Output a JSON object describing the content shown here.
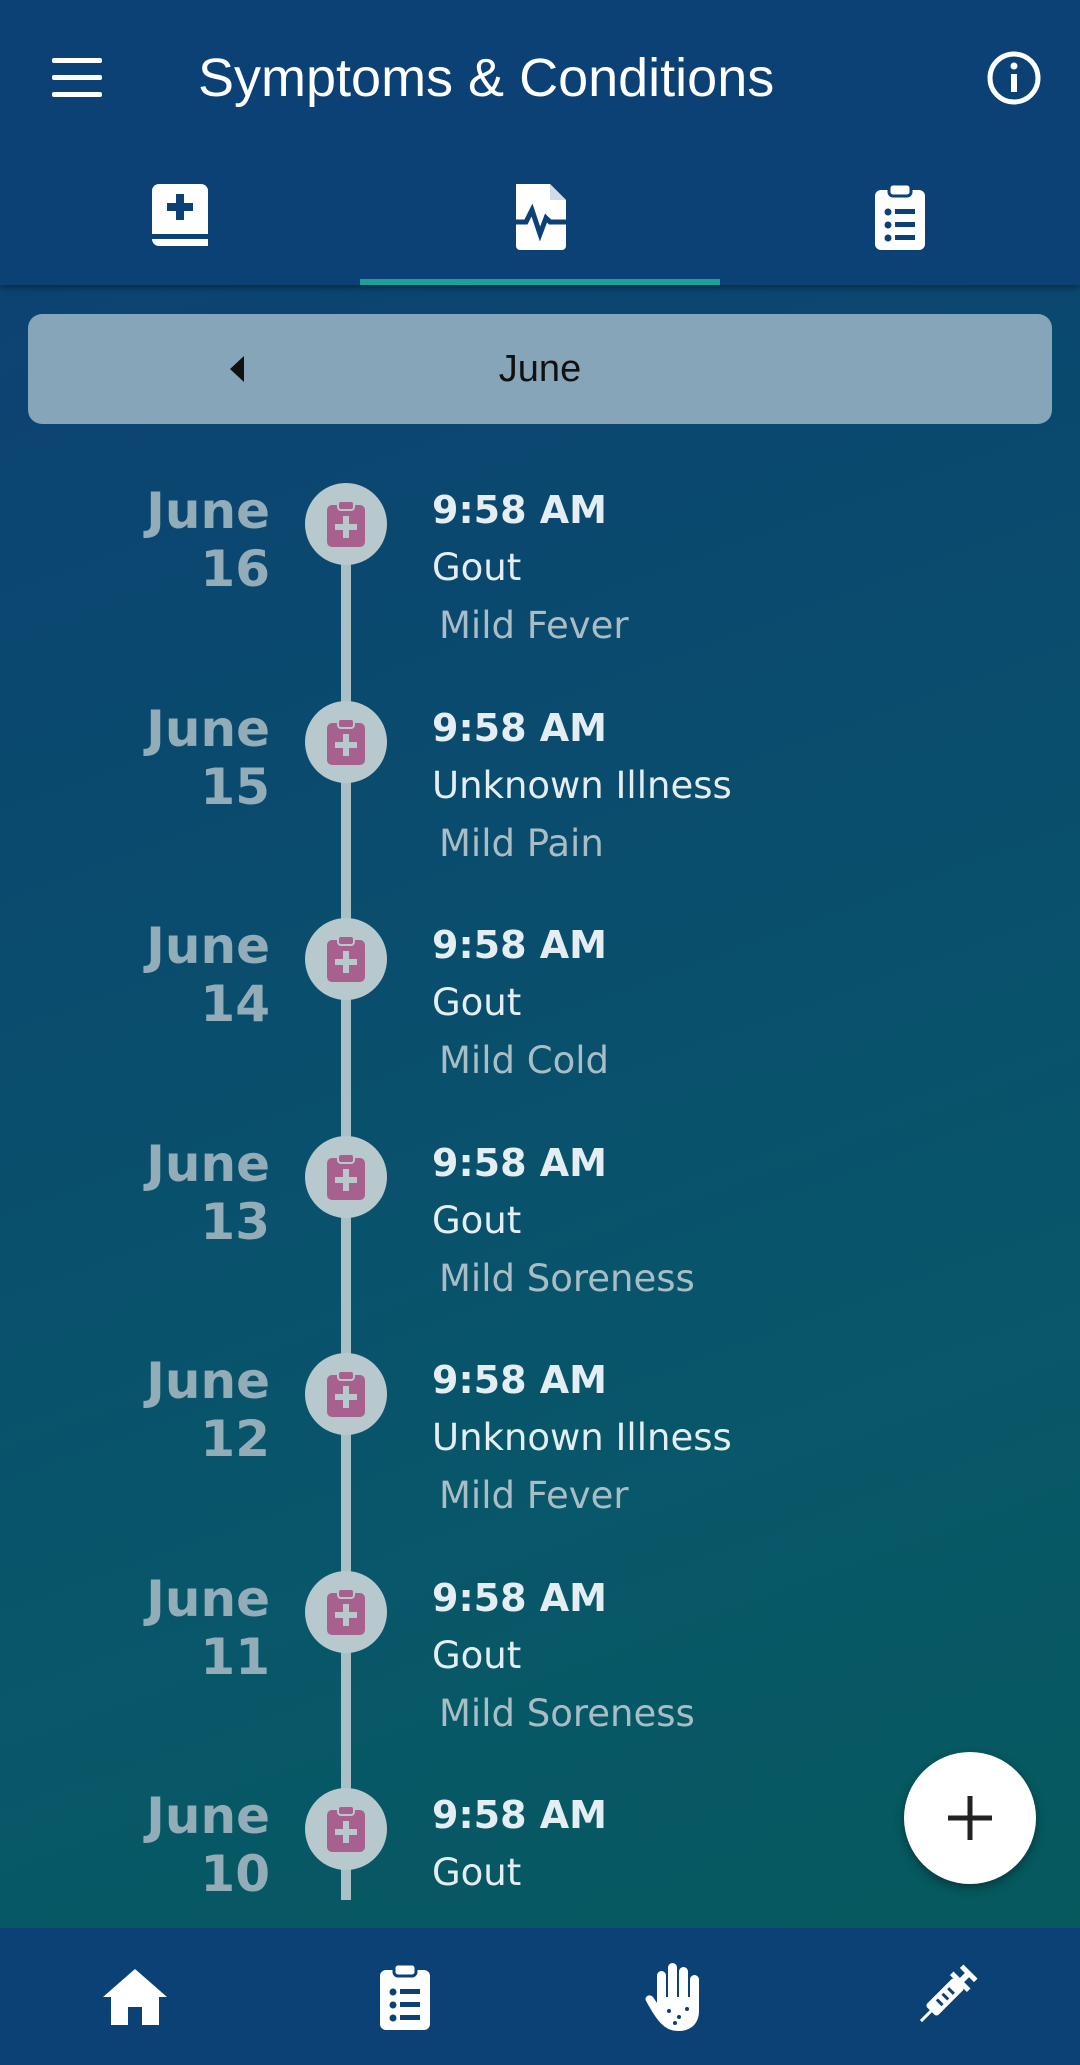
{
  "header": {
    "title": "Symptoms & Conditions",
    "menu_icon": "menu-icon",
    "info_icon": "info-icon"
  },
  "tabs": [
    {
      "icon": "medical-book-icon",
      "selected": false
    },
    {
      "icon": "file-pulse-icon",
      "selected": true
    },
    {
      "icon": "clipboard-list-icon",
      "selected": false
    }
  ],
  "month_selector": {
    "label": "June",
    "prev_icon": "caret-left-icon"
  },
  "entries": [
    {
      "date": "June 16",
      "time": "9:58 AM",
      "condition": "Gout",
      "severity": "Mild Fever"
    },
    {
      "date": "June 15",
      "time": "9:58 AM",
      "condition": "Unknown Illness",
      "severity": "Mild Pain"
    },
    {
      "date": "June 14",
      "time": "9:58 AM",
      "condition": "Gout",
      "severity": "Mild Cold"
    },
    {
      "date": "June 13",
      "time": "9:58 AM",
      "condition": "Gout",
      "severity": "Mild Soreness"
    },
    {
      "date": "June 12",
      "time": "9:58 AM",
      "condition": "Unknown Illness",
      "severity": "Mild Fever"
    },
    {
      "date": "June 11",
      "time": "9:58 AM",
      "condition": "Gout",
      "severity": "Mild Soreness"
    },
    {
      "date": "June 10",
      "time": "9:58 AM",
      "condition": "Gout",
      "severity": ""
    }
  ],
  "fab": {
    "icon": "plus-icon"
  },
  "bottom_nav": [
    {
      "icon": "home-icon"
    },
    {
      "icon": "clipboard-list-icon"
    },
    {
      "icon": "hand-icon"
    },
    {
      "icon": "syringe-icon"
    }
  ],
  "colors": {
    "appbar": "#0b4175",
    "tab_indicator": "#1f9e9a",
    "node_icon": "#a8608e",
    "month_bar": "#86a5b9"
  }
}
